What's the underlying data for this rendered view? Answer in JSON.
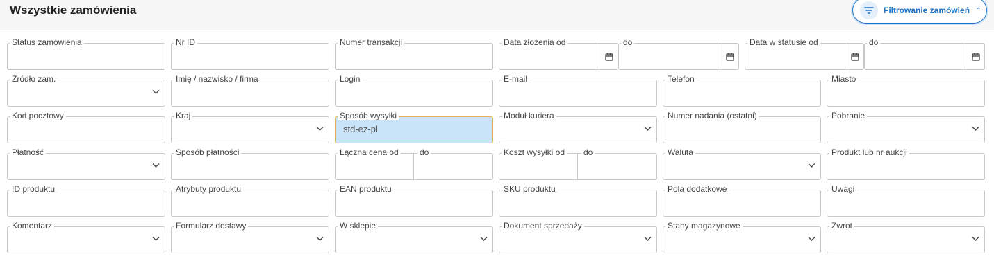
{
  "header": {
    "title": "Wszystkie zamówienia",
    "filter_button": "Filtrowanie zamówień"
  },
  "filters": {
    "status": "Status zamówienia",
    "nr_id": "Nr ID",
    "transaction": "Numer transakcji",
    "date_from": "Data złożenia od",
    "date_to": "do",
    "status_date_from": "Data w statusie od",
    "status_date_to": "do",
    "source": "Źródło zam.",
    "name": "Imię / nazwisko / firma",
    "login": "Login",
    "email": "E-mail",
    "phone": "Telefon",
    "city": "Miasto",
    "postcode": "Kod pocztowy",
    "country": "Kraj",
    "shipping": "Sposób wysyłki",
    "shipping_value": "std-ez-pl",
    "courier": "Moduł kuriera",
    "tracking": "Numer nadania (ostatni)",
    "cod": "Pobranie",
    "payment": "Płatność",
    "payment_method": "Sposób płatności",
    "total_from": "Łączna cena od",
    "total_to": "do",
    "shipping_cost_from": "Koszt wysyłki od",
    "shipping_cost_to": "do",
    "currency": "Waluta",
    "product": "Produkt lub nr aukcji",
    "product_id": "ID produktu",
    "attributes": "Atrybuty produktu",
    "ean": "EAN produktu",
    "sku": "SKU produktu",
    "extra_fields": "Pola dodatkowe",
    "notes": "Uwagi",
    "comment": "Komentarz",
    "delivery_form": "Formularz dostawy",
    "in_store": "W sklepie",
    "sales_doc": "Dokument sprzedaży",
    "stock": "Stany magazynowe",
    "return": "Zwrot"
  },
  "colors": {
    "accent": "#1a73c9",
    "active_field": "#c9e3f8"
  },
  "icons": [
    "filter-icon",
    "chevron-up-icon",
    "calendar-icon",
    "chevron-down-icon"
  ]
}
